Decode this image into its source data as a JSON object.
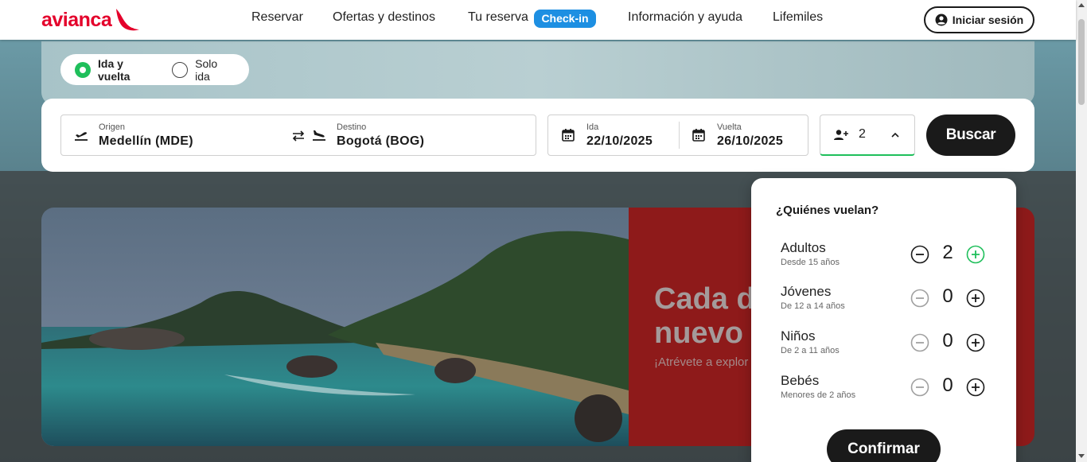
{
  "brand": {
    "name": "avianca",
    "color": "#e4002b"
  },
  "nav": {
    "items": [
      {
        "label": "Reservar"
      },
      {
        "label": "Ofertas y destinos"
      },
      {
        "label": "Tu reserva"
      },
      {
        "label": "Información y ayuda"
      },
      {
        "label": "Lifemiles"
      }
    ],
    "checkin_badge": "Check-in",
    "login_label": "Iniciar sesión"
  },
  "trip_type": {
    "options": [
      {
        "label": "Ida y vuelta",
        "selected": true
      },
      {
        "label": "Solo ida",
        "selected": false
      }
    ]
  },
  "search": {
    "origin": {
      "label": "Origen",
      "city": "Medellín",
      "code": "(MDE)"
    },
    "destination": {
      "label": "Destino",
      "city": "Bogotá",
      "code": "(BOG)"
    },
    "departure": {
      "label": "Ida",
      "value": "22/10/2025"
    },
    "return": {
      "label": "Vuelta",
      "value": "26/10/2025"
    },
    "passengers_total": "2",
    "search_label": "Buscar"
  },
  "promo": {
    "title": "Cada de\nnuevo",
    "subtitle": "¡Atrévete a explor"
  },
  "passengers": {
    "title": "¿Quiénes vuelan?",
    "rows": [
      {
        "name": "Adultos",
        "desc": "Desde 15 años",
        "count": "2",
        "minus_enabled": true,
        "plus_color": "#1fbf5b"
      },
      {
        "name": "Jóvenes",
        "desc": "De 12 a 14 años",
        "count": "0",
        "minus_enabled": false,
        "plus_color": "#1a1a1a"
      },
      {
        "name": "Niños",
        "desc": "De 2 a 11 años",
        "count": "0",
        "minus_enabled": false,
        "plus_color": "#1a1a1a"
      },
      {
        "name": "Bebés",
        "desc": "Menores de 2 años",
        "count": "0",
        "minus_enabled": false,
        "plus_color": "#1a1a1a"
      }
    ],
    "confirm_label": "Confirmar"
  },
  "icons": {
    "departure": "plane-takeoff-icon",
    "arrival": "plane-landing-icon",
    "swap": "swap-arrows-icon",
    "calendar": "calendar-icon",
    "passenger": "add-person-icon",
    "chevron": "chevron-up-icon",
    "user": "user-circle-icon"
  }
}
